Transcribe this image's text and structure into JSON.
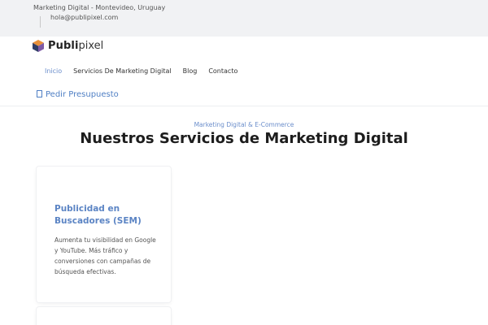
{
  "topbar": {
    "location": "Marketing Digital - Montevideo, Uruguay",
    "email": "hola@publipixel.com"
  },
  "brand": {
    "name_bold": "Publi",
    "name_light": "pixel",
    "colors": {
      "orange": "#e8903a",
      "navy": "#2f3d66",
      "purple": "#7d5aa6"
    }
  },
  "nav": {
    "items": [
      {
        "label": "Inicio",
        "active": true
      },
      {
        "label": "Servicios De Marketing Digital",
        "active": false
      },
      {
        "label": "Blog",
        "active": false
      },
      {
        "label": "Contacto",
        "active": false
      }
    ]
  },
  "cta": {
    "label": "Pedir Presupuesto",
    "icon": "document-icon"
  },
  "hero": {
    "kicker": "Marketing Digital & E-Commerce",
    "title": "Nuestros Servicios de Marketing Digital"
  },
  "services": [
    {
      "title": "Publicidad en Buscadores (SEM)",
      "description": "Aumenta tu visibilidad en Google y YouTube. Más tráfico y conversiones con campañas de búsqueda efectivas."
    }
  ],
  "colors": {
    "accent": "#5b84c4",
    "link": "#6b8ecb",
    "topbar_bg": "#f1f2f4"
  }
}
